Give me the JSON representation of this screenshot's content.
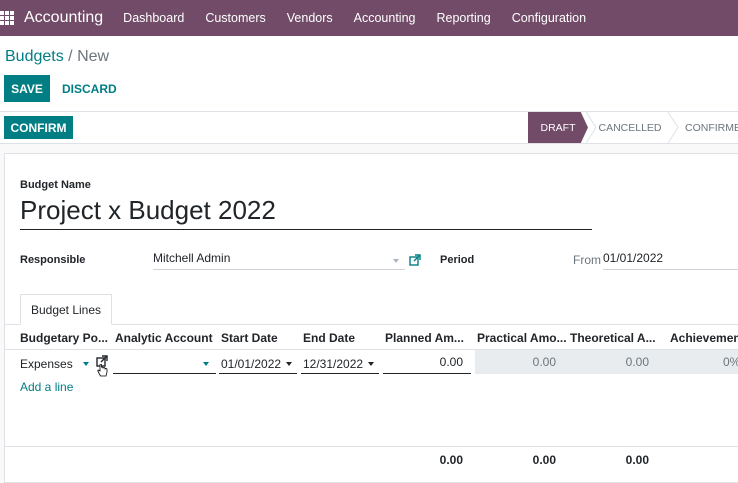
{
  "topbar": {
    "app_name": "Accounting",
    "menu": [
      "Dashboard",
      "Customers",
      "Vendors",
      "Accounting",
      "Reporting",
      "Configuration"
    ],
    "color": "#714b67"
  },
  "breadcrumb": {
    "parent": "Budgets",
    "separator": " / ",
    "current": "New"
  },
  "buttons": {
    "save": "SAVE",
    "discard": "DISCARD",
    "confirm": "CONFIRM"
  },
  "statusbar": {
    "stages": [
      "DRAFT",
      "CANCELLED",
      "CONFIRMED"
    ],
    "active": "DRAFT"
  },
  "form": {
    "budget_name_label": "Budget Name",
    "budget_name": "Project x Budget 2022",
    "responsible_label": "Responsible",
    "responsible": "Mitchell Admin",
    "period_label": "Period",
    "period_from_label": "From",
    "period_from": "01/01/2022"
  },
  "tabs": [
    "Budget Lines"
  ],
  "lines": {
    "headers": [
      "Budgetary Po...",
      "Analytic Account",
      "Start Date",
      "End Date",
      "Planned Am...",
      "Practical Amo...",
      "Theoretical A...",
      "Achievement"
    ],
    "rows": [
      {
        "budgetary_position": "Expenses",
        "analytic_account": "",
        "start_date": "01/01/2022",
        "end_date": "12/31/2022",
        "planned": "0.00",
        "practical": "0.00",
        "theoretical": "0.00",
        "achievement": "0%"
      }
    ],
    "add_line": "Add a line",
    "totals": {
      "planned": "0.00",
      "practical": "0.00",
      "theoretical": "0.00"
    }
  },
  "accent_color": "#017e84"
}
